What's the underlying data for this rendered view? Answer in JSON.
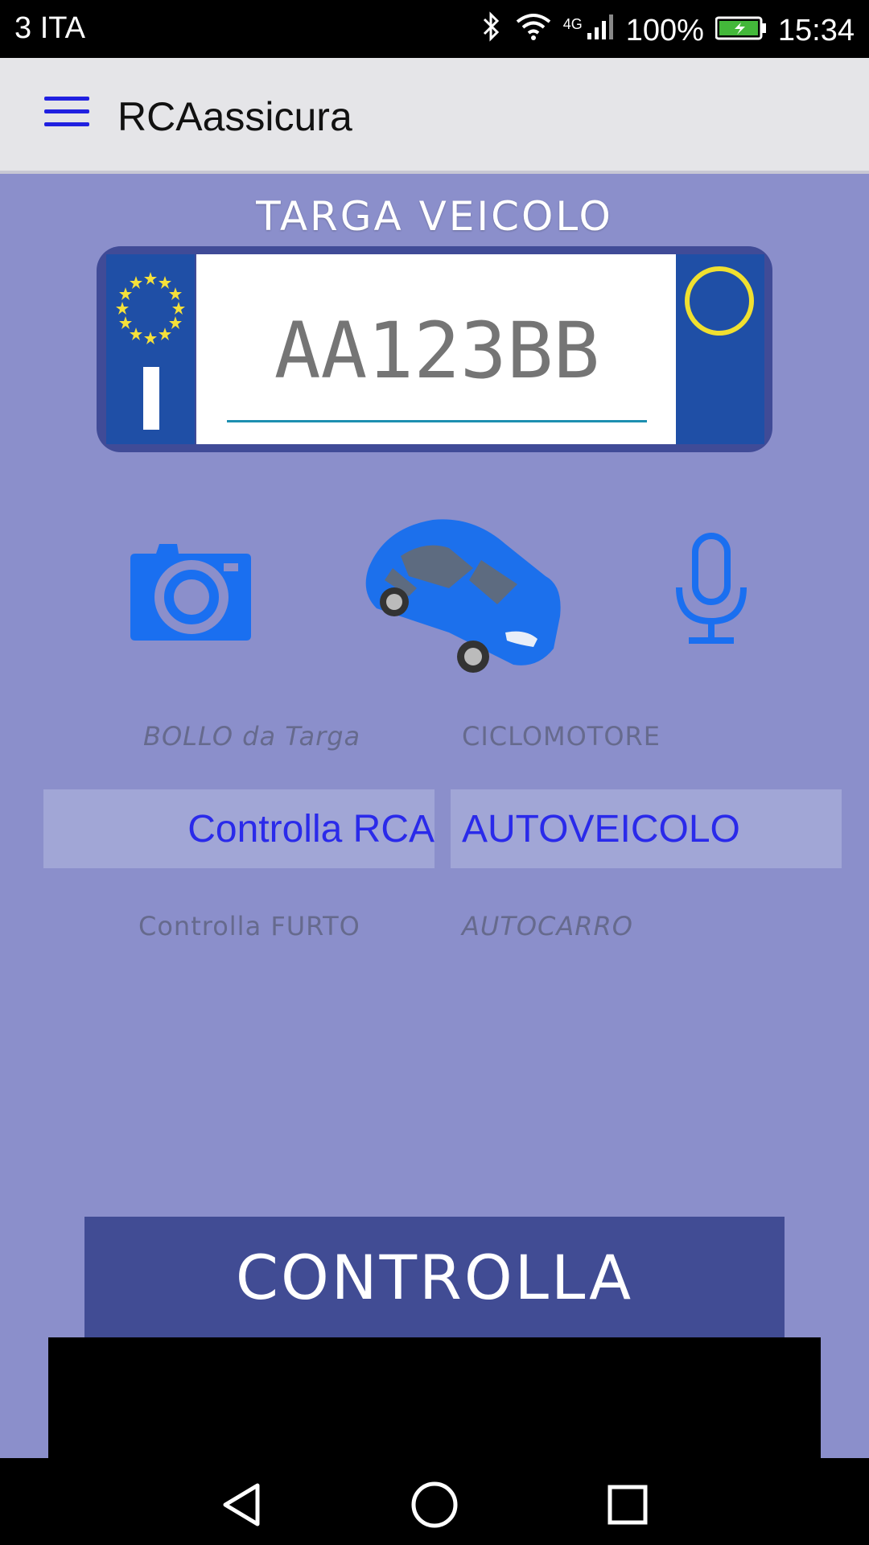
{
  "status_bar": {
    "carrier": "3 ITA",
    "network": "4G",
    "battery": "100%",
    "time": "15:34"
  },
  "app_bar": {
    "title": "RCAassicura"
  },
  "plate_section": {
    "title": "TARGA VEICOLO",
    "plate_placeholder": "AA123BB",
    "country_code": "I"
  },
  "icons": {
    "camera": "camera-icon",
    "car": "car-icon",
    "microphone": "microphone-icon"
  },
  "check_options": {
    "bollo": "BOLLO da Targa",
    "rca": "Controlla RCA",
    "furto": "Controlla FURTO"
  },
  "vehicle_options": {
    "ciclomotore": "CICLOMOTORE",
    "autoveicolo": "AUTOVEICOLO",
    "autocarro": "AUTOCARRO"
  },
  "action": {
    "button_label": "CONTROLLA"
  },
  "colors": {
    "background": "#8b8fcb",
    "accent_blue": "#2a2aea",
    "plate_blue": "#1f4fa6",
    "button_bg": "#414c94"
  }
}
